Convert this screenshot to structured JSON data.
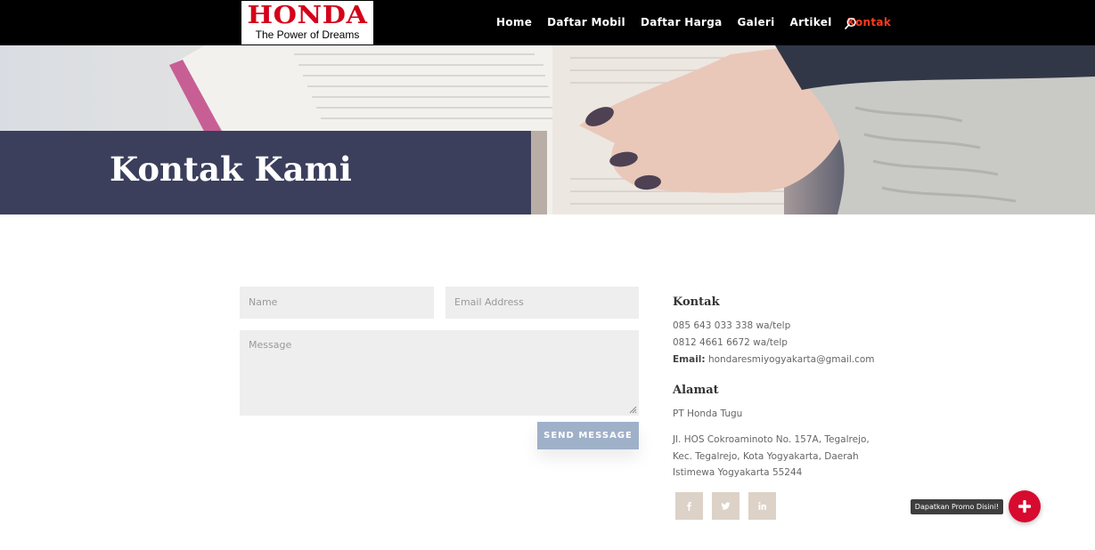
{
  "header": {
    "logo": {
      "brand": "HONDA",
      "tagline": "The Power of Dreams"
    },
    "nav": [
      {
        "label": "Home",
        "active": false
      },
      {
        "label": "Daftar Mobil",
        "active": false
      },
      {
        "label": "Daftar Harga",
        "active": false
      },
      {
        "label": "Galeri",
        "active": false
      },
      {
        "label": "Artikel",
        "active": false
      },
      {
        "label": "Kontak",
        "active": true
      }
    ],
    "search_icon": "search-icon"
  },
  "hero": {
    "title": "Kontak Kami"
  },
  "form": {
    "name_placeholder": "Name",
    "email_placeholder": "Email Address",
    "message_placeholder": "Message",
    "submit_label": "SEND MESSAGE"
  },
  "contact": {
    "heading": "Kontak",
    "phone1": "085 643 033 338 wa/telp",
    "phone2": "0812 4661 6672 wa/telp",
    "email_label": "Email:",
    "email": "hondaresmiyogyakarta@gmail.com"
  },
  "address": {
    "heading": "Alamat",
    "company": "PT Honda Tugu",
    "lines": [
      "Jl. HOS Cokroaminoto No. 157A, Tegalrejo,",
      "Kec. Tegalrejo, Kota Yogyakarta, Daerah",
      "Istimewa Yogyakarta 55244"
    ]
  },
  "social": [
    "facebook-icon",
    "twitter-icon",
    "linkedin-icon"
  ],
  "promo": {
    "label": "Dapatkan Promo Disini!"
  },
  "colors": {
    "brand_red": "#d4001a",
    "nav_active": "#ff3a1f",
    "hero_band": "#3b3f5c",
    "button": "#9fb0c9",
    "social_bg": "#dcd2c7",
    "promo_red": "#d70a2f"
  }
}
